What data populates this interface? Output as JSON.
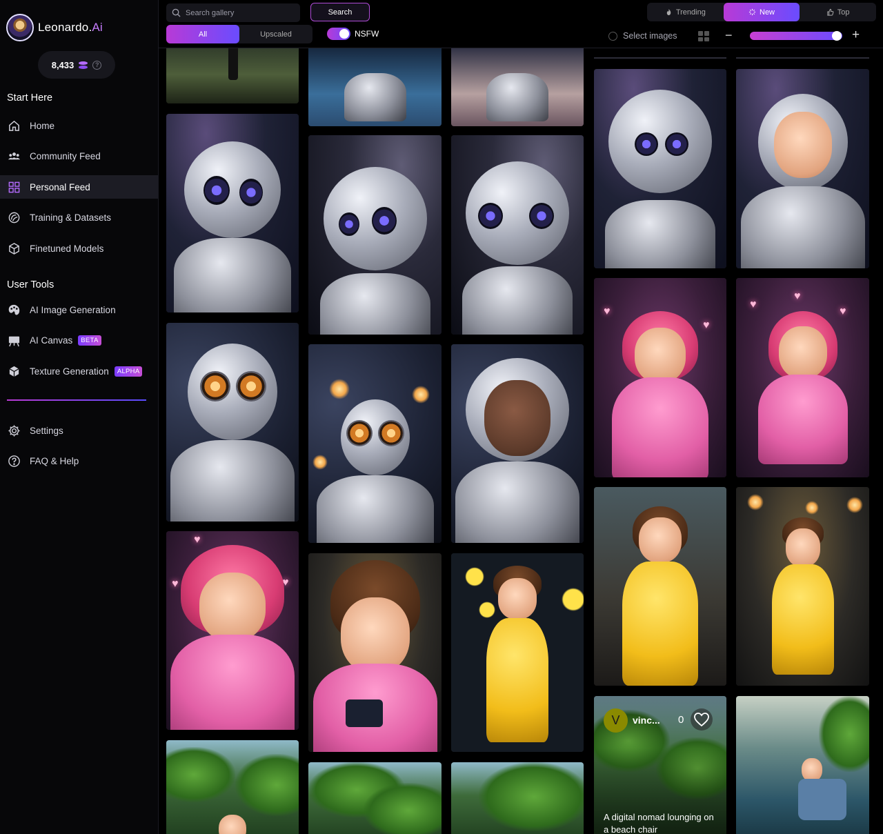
{
  "brand": {
    "name": "Leonardo.",
    "suffix": "Ai"
  },
  "credits": {
    "amount": "8,433",
    "help": "?"
  },
  "sidebar": {
    "start_title": "Start Here",
    "start_items": [
      {
        "label": "Home",
        "icon": "home-icon"
      },
      {
        "label": "Community Feed",
        "icon": "community-icon"
      },
      {
        "label": "Personal Feed",
        "icon": "grid-icon",
        "active": true
      },
      {
        "label": "Training & Datasets",
        "icon": "training-icon"
      },
      {
        "label": "Finetuned Models",
        "icon": "cube-icon"
      }
    ],
    "tools_title": "User Tools",
    "tool_items": [
      {
        "label": "AI Image Generation",
        "icon": "palette-icon"
      },
      {
        "label": "AI Canvas",
        "icon": "easel-icon",
        "badge": "BETA"
      },
      {
        "label": "Texture Generation",
        "icon": "texture-cube-icon",
        "badge": "ALPHA"
      }
    ],
    "bottom_items": [
      {
        "label": "Settings",
        "icon": "gear-icon"
      },
      {
        "label": "FAQ & Help",
        "icon": "help-icon"
      }
    ]
  },
  "toolbar": {
    "search_placeholder": "Search gallery",
    "search_button": "Search",
    "filter_all": "All",
    "filter_upscaled": "Upscaled",
    "nsfw_label": "NSFW",
    "nsfw_enabled": true,
    "sort_trending": "Trending",
    "sort_new": "New",
    "sort_top": "Top",
    "select_images": "Select images",
    "zoom_minus": "−",
    "zoom_plus": "+"
  },
  "feature_card": {
    "avatar_letter": "V",
    "username": "vinc...",
    "likes": "0",
    "caption": "A digital nomad lounging on a beach chair"
  },
  "colors": {
    "accent_start": "#b83ad6",
    "accent_end": "#6a4cff",
    "background": "#000000",
    "sidebar": "#070709"
  }
}
